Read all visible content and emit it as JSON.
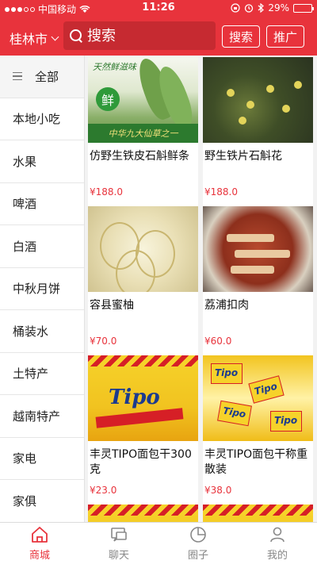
{
  "status_bar": {
    "carrier": "中国移动",
    "time": "11:26",
    "battery": "29%",
    "battery_level": 0.29,
    "icons": [
      "wifi-icon",
      "lock-rotation-icon",
      "alarm-icon",
      "bluetooth-icon",
      "battery-icon"
    ]
  },
  "header": {
    "city": "桂林市",
    "search_placeholder": "搜索",
    "search_button": "搜索",
    "promo_button": "推广",
    "accent_color": "#e8333c"
  },
  "sidebar": {
    "items": [
      {
        "label": "全部"
      },
      {
        "label": "本地小吃"
      },
      {
        "label": "水果"
      },
      {
        "label": "啤酒"
      },
      {
        "label": "白酒"
      },
      {
        "label": "中秋月饼"
      },
      {
        "label": "桶装水"
      },
      {
        "label": "土特产"
      },
      {
        "label": "越南特产"
      },
      {
        "label": "家电"
      },
      {
        "label": "家俱"
      }
    ]
  },
  "products": [
    {
      "title": "仿野生铁皮石斛鲜条",
      "price": "¥188.0",
      "image_text": {
        "top": "天然鲜滋味",
        "badge": "鲜",
        "bottom": "中华九大仙草之一"
      }
    },
    {
      "title": "野生铁片石斛花",
      "price": "¥188.0"
    },
    {
      "title": "容县蜜柚",
      "price": "¥70.0"
    },
    {
      "title": "荔浦扣肉",
      "price": "¥60.0"
    },
    {
      "title": "丰灵TIPO面包干300克",
      "price": "¥23.0",
      "image_text": {
        "logo": "Tipo"
      }
    },
    {
      "title": "丰灵TIPO面包干称重散装",
      "price": "¥38.0",
      "image_text": {
        "logo": "Tipo"
      }
    }
  ],
  "tabbar": {
    "tabs": [
      {
        "label": "商城",
        "icon": "home-icon",
        "active": true
      },
      {
        "label": "聊天",
        "icon": "chat-icon",
        "active": false
      },
      {
        "label": "圈子",
        "icon": "pie-chart-icon",
        "active": false
      },
      {
        "label": "我的",
        "icon": "user-icon",
        "active": false
      }
    ]
  }
}
